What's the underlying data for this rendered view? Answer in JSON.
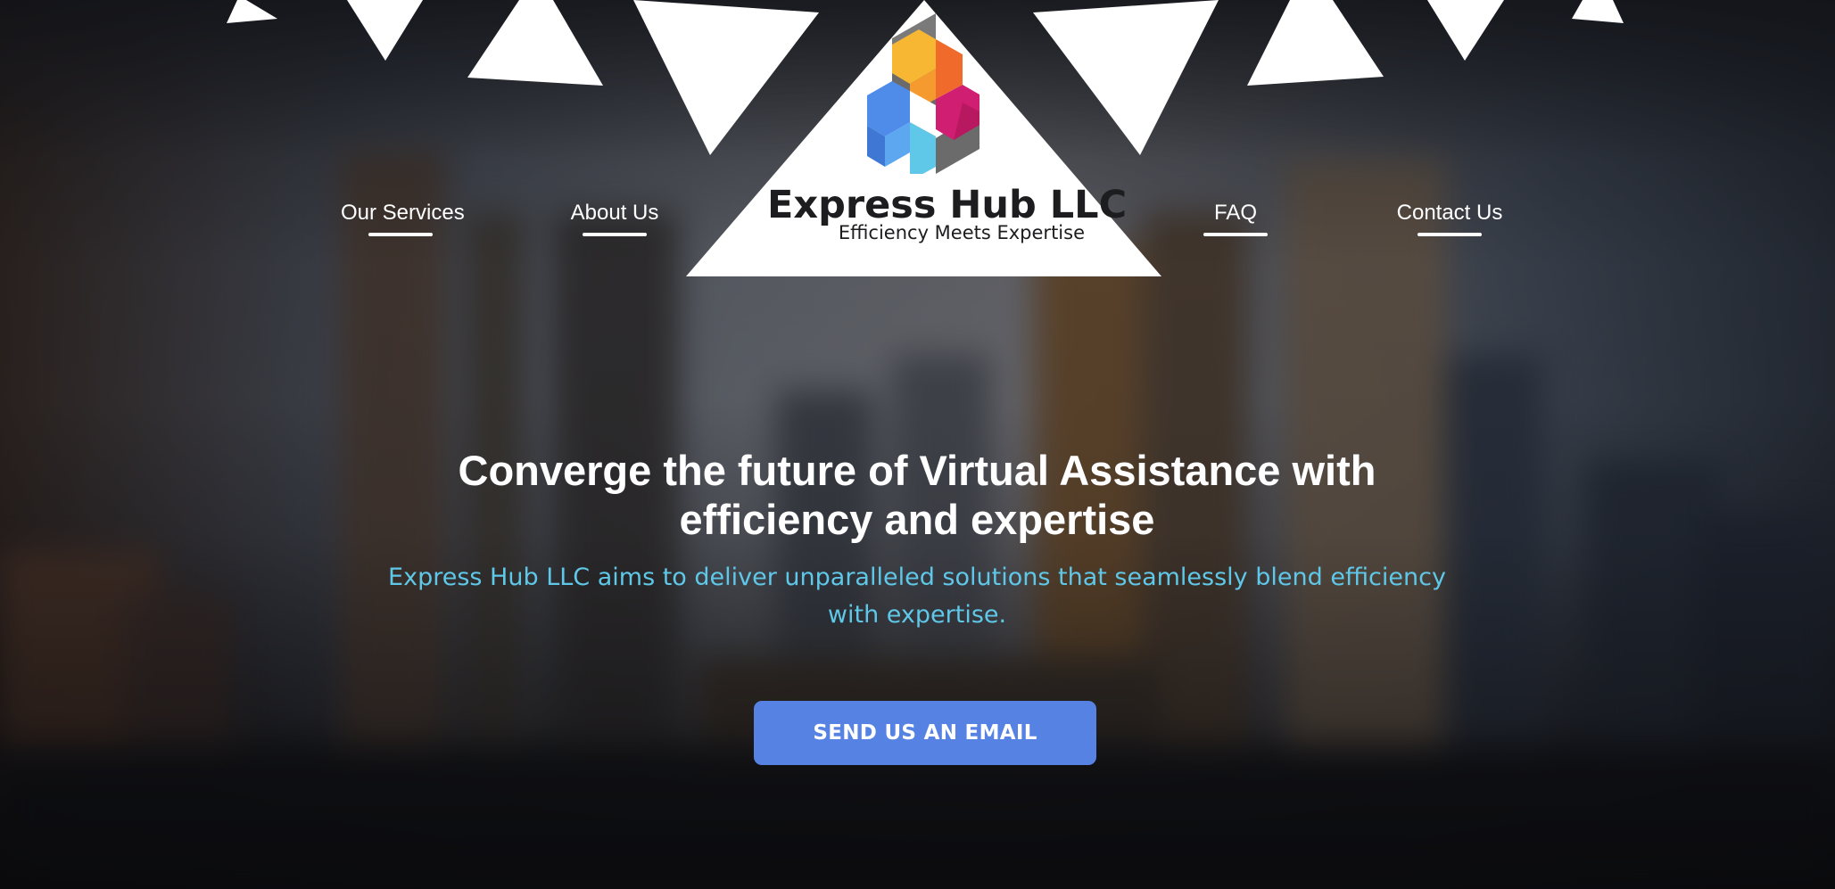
{
  "colors": {
    "accent_button": "#5683e3",
    "subtitle": "#5fc8e8",
    "nav_text": "#ffffff",
    "brand_text": "#1d1d1f"
  },
  "nav": {
    "left": [
      {
        "label": "Our Services"
      },
      {
        "label": "About Us"
      }
    ],
    "right": [
      {
        "label": "FAQ"
      },
      {
        "label": "Contact Us"
      }
    ]
  },
  "brand": {
    "name": "Express Hub LLC",
    "tagline": "Efficiency Meets Expertise",
    "logo_icon": "hexagon-cube-logo-icon"
  },
  "hero": {
    "title": "Converge the future of Virtual Assistance with efficiency and expertise",
    "subtitle": "Express Hub LLC aims to deliver unparalleled solutions that seamlessly blend efficiency with expertise.",
    "cta_label": "SEND US AN EMAIL"
  }
}
